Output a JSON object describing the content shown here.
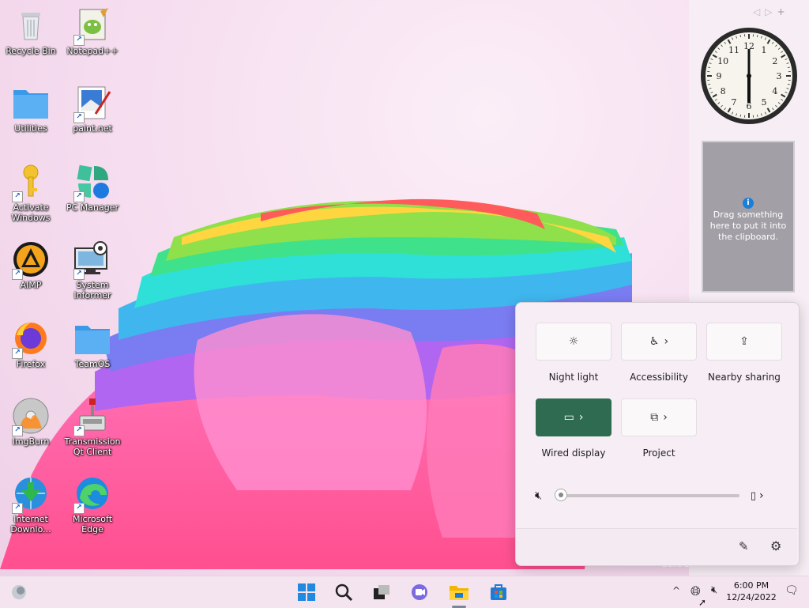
{
  "desktop": {
    "icons": [
      {
        "label": "Recycle Bin"
      },
      {
        "label": "Notepad++"
      },
      {
        "label": "Utilities"
      },
      {
        "label": "paint.net"
      },
      {
        "label": "Activate Windows"
      },
      {
        "label": "PC Manager"
      },
      {
        "label": "AIMP"
      },
      {
        "label": "System Informer"
      },
      {
        "label": "Firefox"
      },
      {
        "label": "TeamOS"
      },
      {
        "label": "ImgBurn"
      },
      {
        "label": "Transmission Qt Client"
      },
      {
        "label": "Internet Downlo..."
      },
      {
        "label": "Microsoft Edge"
      }
    ],
    "build_text": "Build 2"
  },
  "gadgets": {
    "clock": {
      "numbers": [
        "12",
        "1",
        "2",
        "3",
        "4",
        "5",
        "6",
        "7",
        "8",
        "9",
        "10",
        "11"
      ],
      "time": "6:00"
    },
    "clipboard_text": "Drag something here to put it into the clipboard.",
    "info_glyph": "i",
    "controls": [
      "◁",
      "▷",
      "+"
    ]
  },
  "quick_settings": {
    "tiles": [
      {
        "label": "Night light",
        "icon": "brightness-icon",
        "active": false
      },
      {
        "label": "Accessibility",
        "icon": "accessibility-icon",
        "active": false,
        "expand": "›"
      },
      {
        "label": "Nearby sharing",
        "icon": "share-icon",
        "active": false
      },
      {
        "label": "Wired display",
        "icon": "cast-icon",
        "active": true,
        "expand": "›"
      },
      {
        "label": "Project",
        "icon": "project-icon",
        "active": false,
        "expand": "›"
      }
    ],
    "volume": {
      "level": 0,
      "muted": true,
      "expand": "›"
    },
    "accent_color": "#2e6b50"
  },
  "taskbar": {
    "tray_chevron": "^",
    "time": "6:00 PM",
    "date": "12/24/2022"
  }
}
